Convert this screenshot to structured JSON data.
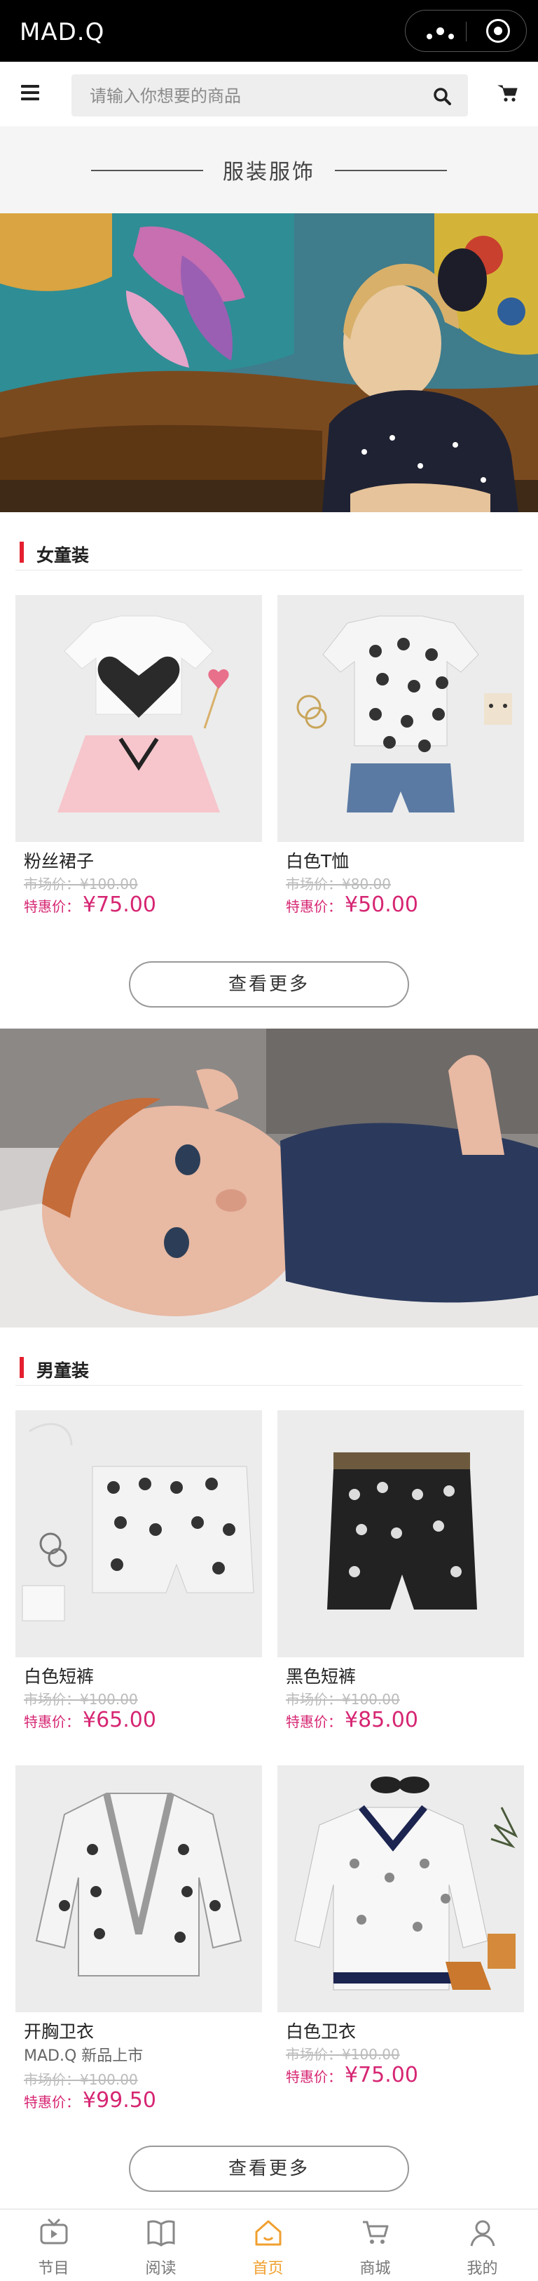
{
  "app": {
    "title": "MAD.Q"
  },
  "search": {
    "placeholder": "请输入你想要的商品"
  },
  "section": {
    "title": "服装服饰"
  },
  "girls": {
    "heading": "女童装",
    "products": [
      {
        "name": "粉丝裙子",
        "market_price": "市场价：¥100.00",
        "sale_label": "特惠价：",
        "sale_price": "¥75.00"
      },
      {
        "name": "白色T恤",
        "market_price": "市场价：¥80.00",
        "sale_label": "特惠价：",
        "sale_price": "¥50.00"
      }
    ],
    "more_label": "查看更多"
  },
  "boys": {
    "heading": "男童装",
    "products": [
      {
        "name": "白色短裤",
        "market_price": "市场价：¥100.00",
        "sale_label": "特惠价：",
        "sale_price": "¥65.00"
      },
      {
        "name": "黑色短裤",
        "market_price": "市场价：¥100.00",
        "sale_label": "特惠价：",
        "sale_price": "¥85.00"
      },
      {
        "name": "开胸卫衣",
        "subtitle": "MAD.Q 新品上市",
        "market_price": "市场价：¥100.00",
        "sale_label": "特惠价：",
        "sale_price": "¥99.50"
      },
      {
        "name": "白色卫衣",
        "market_price": "市场价：¥100.00",
        "sale_label": "特惠价：",
        "sale_price": "¥75.00"
      }
    ],
    "more_label": "查看更多"
  },
  "tabs": [
    {
      "label": "节目",
      "icon": "tv-icon"
    },
    {
      "label": "阅读",
      "icon": "book-icon"
    },
    {
      "label": "首页",
      "icon": "home-icon",
      "active": true
    },
    {
      "label": "商城",
      "icon": "cart-icon"
    },
    {
      "label": "我的",
      "icon": "user-icon"
    }
  ],
  "colors": {
    "accent": "#e4202e",
    "price": "#d62673",
    "active_tab": "#f0a030"
  }
}
